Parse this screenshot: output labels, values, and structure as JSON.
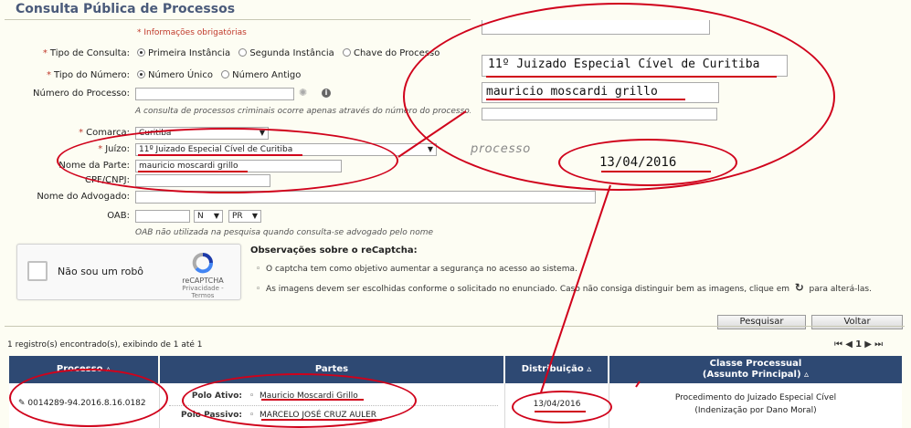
{
  "title": "Consulta Pública de Processos",
  "required_note": "* Informações obrigatórias",
  "form": {
    "tipo_consulta": {
      "label": "Tipo de Consulta:",
      "options": [
        "Primeira Instância",
        "Segunda Instância",
        "Chave do Processo"
      ]
    },
    "tipo_numero": {
      "label": "Tipo do Número:",
      "options": [
        "Número Único",
        "Número Antigo"
      ]
    },
    "numero_processo": {
      "label": "Número do Processo:",
      "value": "",
      "hint": "A consulta de processos criminais ocorre apenas através do número do processo."
    },
    "comarca": {
      "label": "Comarca:",
      "value": "Curitiba"
    },
    "juizo": {
      "label": "Juízo:",
      "value": "11º Juizado Especial Cível de Curitiba"
    },
    "nome_parte": {
      "label": "Nome da Parte:",
      "value": "mauricio moscardi grillo"
    },
    "cpf": {
      "label": "CPF/CNPJ:",
      "value": ""
    },
    "advogado": {
      "label": "Nome do Advogado:",
      "value": ""
    },
    "oab": {
      "label": "OAB:",
      "value": "",
      "tipo": "N",
      "uf": "PR",
      "hint": "OAB não utilizada na pesquisa quando consulta-se advogado pelo nome"
    }
  },
  "captcha": {
    "label": "Não sou um robô",
    "brand": "reCAPTCHA",
    "terms": "Privacidade - Termos",
    "obs_title": "Observações sobre o reCaptcha:",
    "obs_items": [
      "O captcha tem como objetivo aumentar a segurança no acesso ao sistema.",
      "As imagens devem ser escolhidas conforme o solicitado no enunciado. Caso não consiga distinguir bem as imagens, clique em",
      "para alterá-las."
    ]
  },
  "buttons": {
    "search": "Pesquisar",
    "back": "Voltar"
  },
  "results": {
    "count_text": "1 registro(s) encontrado(s), exibindo de 1 até 1",
    "page": "1",
    "columns": [
      "Processo",
      "Partes",
      "Distribuição",
      "Classe Processual",
      "(Assunto Principal)"
    ],
    "row": {
      "processo": "0014289-94.2016.8.16.0182",
      "polo_ativo_label": "Polo Ativo:",
      "polo_ativo": "Mauricio Moscardi Grillo",
      "polo_passivo_label": "Polo Passivo:",
      "polo_passivo": "MARCELO JOSÉ CRUZ AULER",
      "distribuicao": "13/04/2016",
      "classe": "Procedimento do Juizado Especial Cível",
      "assunto": "(Indenização por Dano Moral)"
    }
  },
  "zoom": {
    "juizo": "11º Juizado Especial Cível de Curitiba",
    "parte": "mauricio moscardi grillo",
    "processo_word": "processo",
    "data": "13/04/2016"
  },
  "colors": {
    "header": "#2e4973",
    "annotation": "#d0021b",
    "title": "#4a5a7a",
    "required": "#c0392b",
    "background": "#fdfdf3"
  }
}
